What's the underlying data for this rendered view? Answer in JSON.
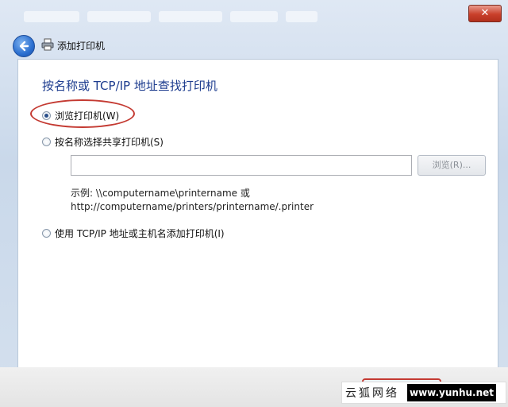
{
  "window": {
    "close_glyph": "✕"
  },
  "nav": {
    "title": "添加打印机",
    "back_icon": "back-arrow-icon",
    "printer_icon": "printer-icon"
  },
  "page": {
    "heading": "按名称或 TCP/IP 地址查找打印机",
    "options": [
      {
        "label": "浏览打印机(W)",
        "checked": true
      },
      {
        "label": "按名称选择共享打印机(S)",
        "checked": false
      },
      {
        "label": "使用 TCP/IP 地址或主机名添加打印机(I)",
        "checked": false
      }
    ],
    "share_input_value": "",
    "browse_button_label": "浏览(R)...",
    "example_line1": "示例: \\\\computername\\printername 或",
    "example_line2": "http://computername/printers/printername/.printer"
  },
  "watermark": {
    "cn": "云狐网络",
    "url": "www.yunhu.net"
  },
  "colors": {
    "heading": "#1e3d8f",
    "highlight": "#c43a32",
    "close": "#c9402b"
  }
}
